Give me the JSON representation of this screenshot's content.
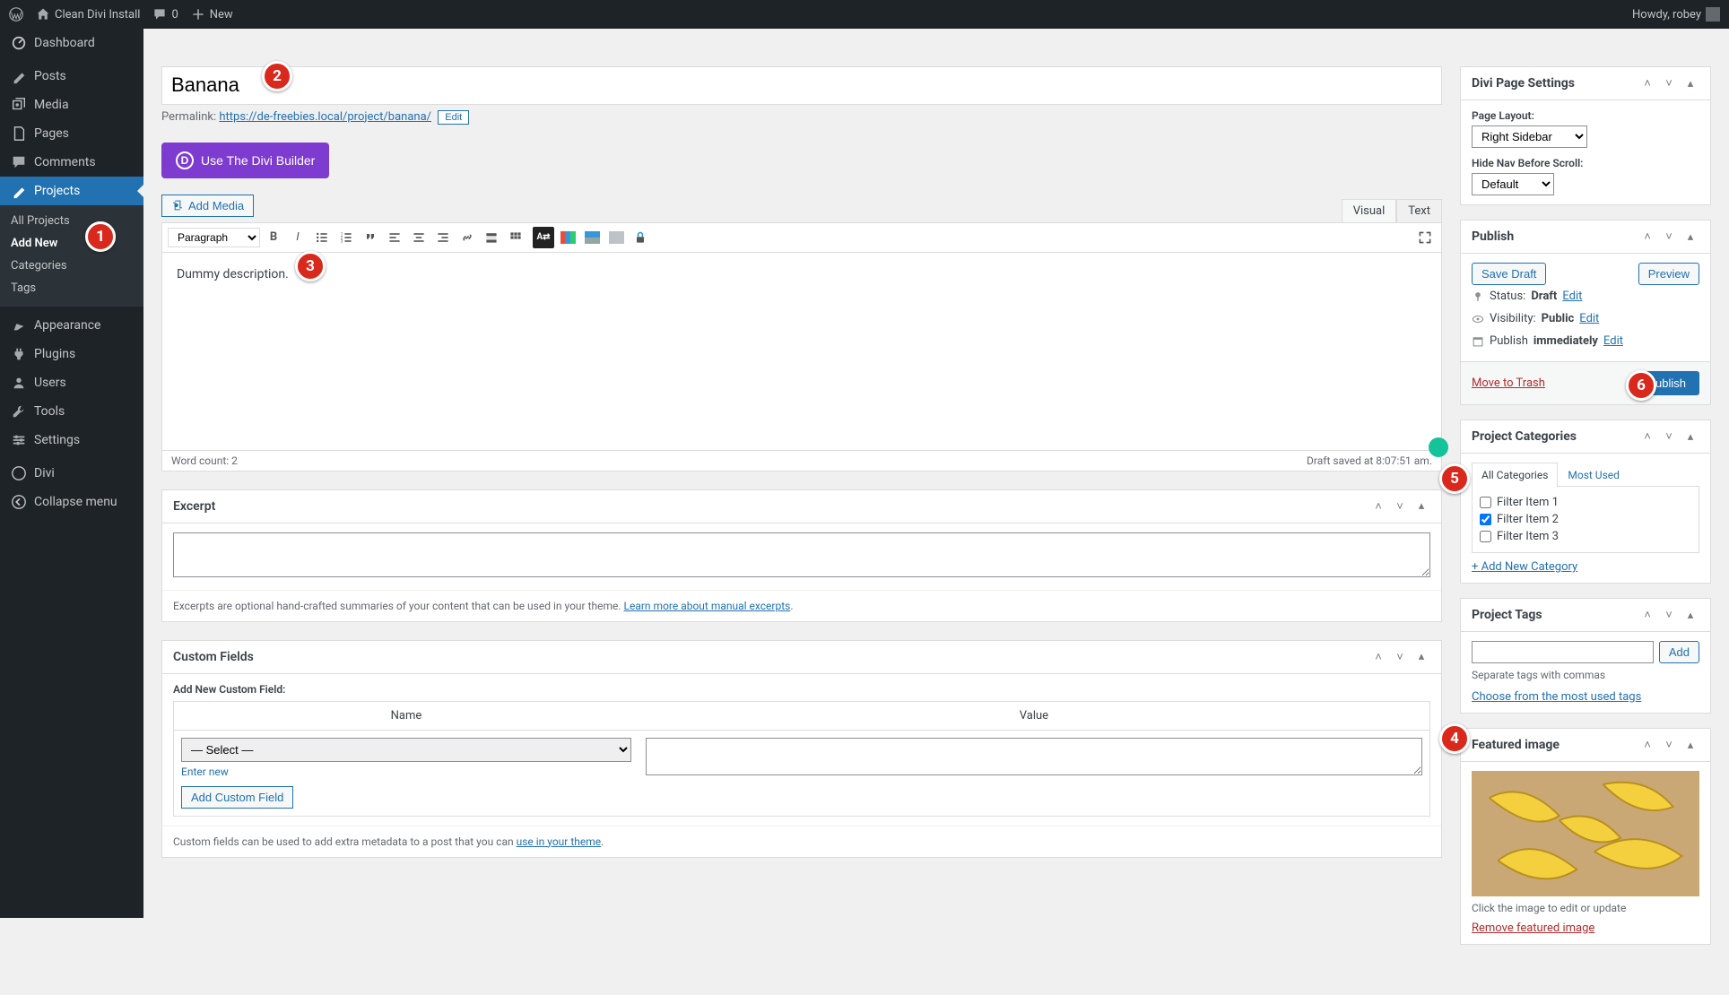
{
  "adminBar": {
    "siteName": "Clean Divi Install",
    "commentsCount": "0",
    "newLabel": "New",
    "howdy": "Howdy, robey"
  },
  "sidebar": {
    "dashboard": "Dashboard",
    "posts": "Posts",
    "media": "Media",
    "pages": "Pages",
    "comments": "Comments",
    "projects": "Projects",
    "projectsSub": {
      "all": "All Projects",
      "addNew": "Add New",
      "categories": "Categories",
      "tags": "Tags"
    },
    "appearance": "Appearance",
    "plugins": "Plugins",
    "users": "Users",
    "tools": "Tools",
    "settings": "Settings",
    "divi": "Divi",
    "collapse": "Collapse menu"
  },
  "title": "Banana",
  "permalinkLabel": "Permalink:",
  "permalinkUrl": "https://de-freebies.local/project/banana/",
  "editBtn": "Edit",
  "diviBuilder": "Use The Divi Builder",
  "addMedia": "Add Media",
  "editorTabs": {
    "visual": "Visual",
    "text": "Text"
  },
  "blockFormat": "Paragraph",
  "editorContent": "Dummy description.",
  "wordCount": "Word count: 2",
  "draftSaved": "Draft saved at 8:07:51 am.",
  "excerpt": {
    "title": "Excerpt",
    "hint": "Excerpts are optional hand-crafted summaries of your content that can be used in your theme.",
    "learnMore": "Learn more about manual excerpts"
  },
  "customFields": {
    "title": "Custom Fields",
    "addNewLabel": "Add New Custom Field:",
    "nameHeader": "Name",
    "valueHeader": "Value",
    "selectPlaceholder": "— Select —",
    "enterNew": "Enter new",
    "addBtn": "Add Custom Field",
    "hint": "Custom fields can be used to add extra metadata to a post that you can",
    "hintLink": "use in your theme"
  },
  "diviSettings": {
    "title": "Divi Page Settings",
    "pageLayoutLabel": "Page Layout:",
    "pageLayoutValue": "Right Sidebar",
    "hideNavLabel": "Hide Nav Before Scroll:",
    "hideNavValue": "Default"
  },
  "publish": {
    "title": "Publish",
    "saveDraft": "Save Draft",
    "preview": "Preview",
    "statusLabel": "Status:",
    "statusValue": "Draft",
    "visibilityLabel": "Visibility:",
    "visibilityValue": "Public",
    "publishLabel": "Publish",
    "publishValue": "immediately",
    "edit": "Edit",
    "trash": "Move to Trash",
    "publishBtn": "Publish"
  },
  "categories": {
    "title": "Project Categories",
    "tabAll": "All Categories",
    "tabMost": "Most Used",
    "items": [
      "Filter Item 1",
      "Filter Item 2",
      "Filter Item 3"
    ],
    "checked": [
      false,
      true,
      false
    ],
    "addNew": "+ Add New Category"
  },
  "tags": {
    "title": "Project Tags",
    "addBtn": "Add",
    "hint": "Separate tags with commas",
    "chooseLink": "Choose from the most used tags"
  },
  "featured": {
    "title": "Featured image",
    "hint": "Click the image to edit or update",
    "removeLink": "Remove featured image"
  },
  "annotations": [
    "1",
    "2",
    "3",
    "4",
    "5",
    "6"
  ]
}
